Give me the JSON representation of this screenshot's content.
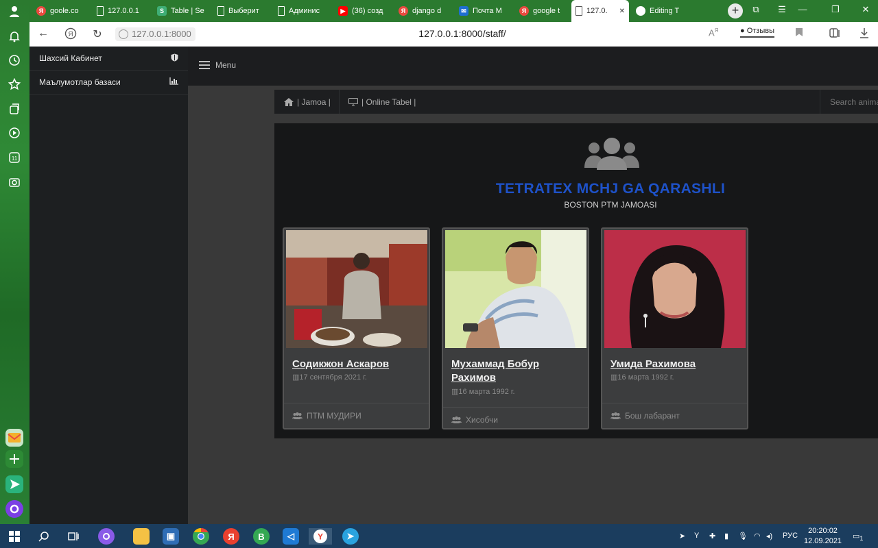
{
  "browser": {
    "tabs": [
      {
        "label": "goole.co",
        "favicon": "yandex-icon",
        "color": "#e94a3f"
      },
      {
        "label": "127.0.0.1",
        "favicon": "page-icon",
        "color": "#ffffff"
      },
      {
        "label": "Table | Se",
        "favicon": "s-icon",
        "color": "#3fae76"
      },
      {
        "label": "Выберит",
        "favicon": "page-icon",
        "color": "#ffffff"
      },
      {
        "label": "Админис",
        "favicon": "page-icon",
        "color": "#ffffff"
      },
      {
        "label": "(36) созд",
        "favicon": "youtube-icon",
        "color": "#ff0000"
      },
      {
        "label": "django d",
        "favicon": "yandex-icon",
        "color": "#e94a3f"
      },
      {
        "label": "Почта М",
        "favicon": "mail-icon",
        "color": "#1f6fd1"
      },
      {
        "label": "google t",
        "favicon": "yandex-icon",
        "color": "#e94a3f"
      },
      {
        "label": "127.0.",
        "favicon": "page-icon",
        "color": "#555555",
        "active": true
      },
      {
        "label": "Editing T",
        "favicon": "github-icon",
        "color": "#ffffff"
      }
    ],
    "address": {
      "host": "127.0.0.1:8000",
      "url": "127.0.0.1:8000/staff/",
      "feedback": "Отзывы"
    }
  },
  "sidebar": {
    "items": [
      {
        "label": "Шахсий Кабинет",
        "icon": "shield-icon"
      },
      {
        "label": "Маълумотлар базаси",
        "icon": "bar-chart-icon"
      }
    ]
  },
  "topbar": {
    "menu_label": "Menu"
  },
  "subnav": {
    "items": [
      {
        "label": "| Jamoa |",
        "icon": "home-icon"
      },
      {
        "label": "| Online Tabel |",
        "icon": "desktop-icon"
      }
    ],
    "search_placeholder": "Search anima"
  },
  "panel": {
    "title": "TETRATEX MCHJ GA QARASHLI",
    "subtitle": "BOSTON PTM JAMOASI",
    "title_color": "#1e52c9"
  },
  "staff": [
    {
      "name": "Содикжон Аскаров",
      "date": "17 сентября 2021 г.",
      "role": "ПТМ МУДИРИ"
    },
    {
      "name": "Мухаммад Бобур Рахимов",
      "date": "16 марта 1992 г.",
      "role": "Хисобчи"
    },
    {
      "name": "Умида Рахимова",
      "date": "16 марта 1992 г.",
      "role": "Бош лабарант"
    }
  ],
  "taskbar": {
    "lang": "РУС",
    "time": "20:20:02",
    "date": "12.09.2021",
    "notifications": "1"
  }
}
